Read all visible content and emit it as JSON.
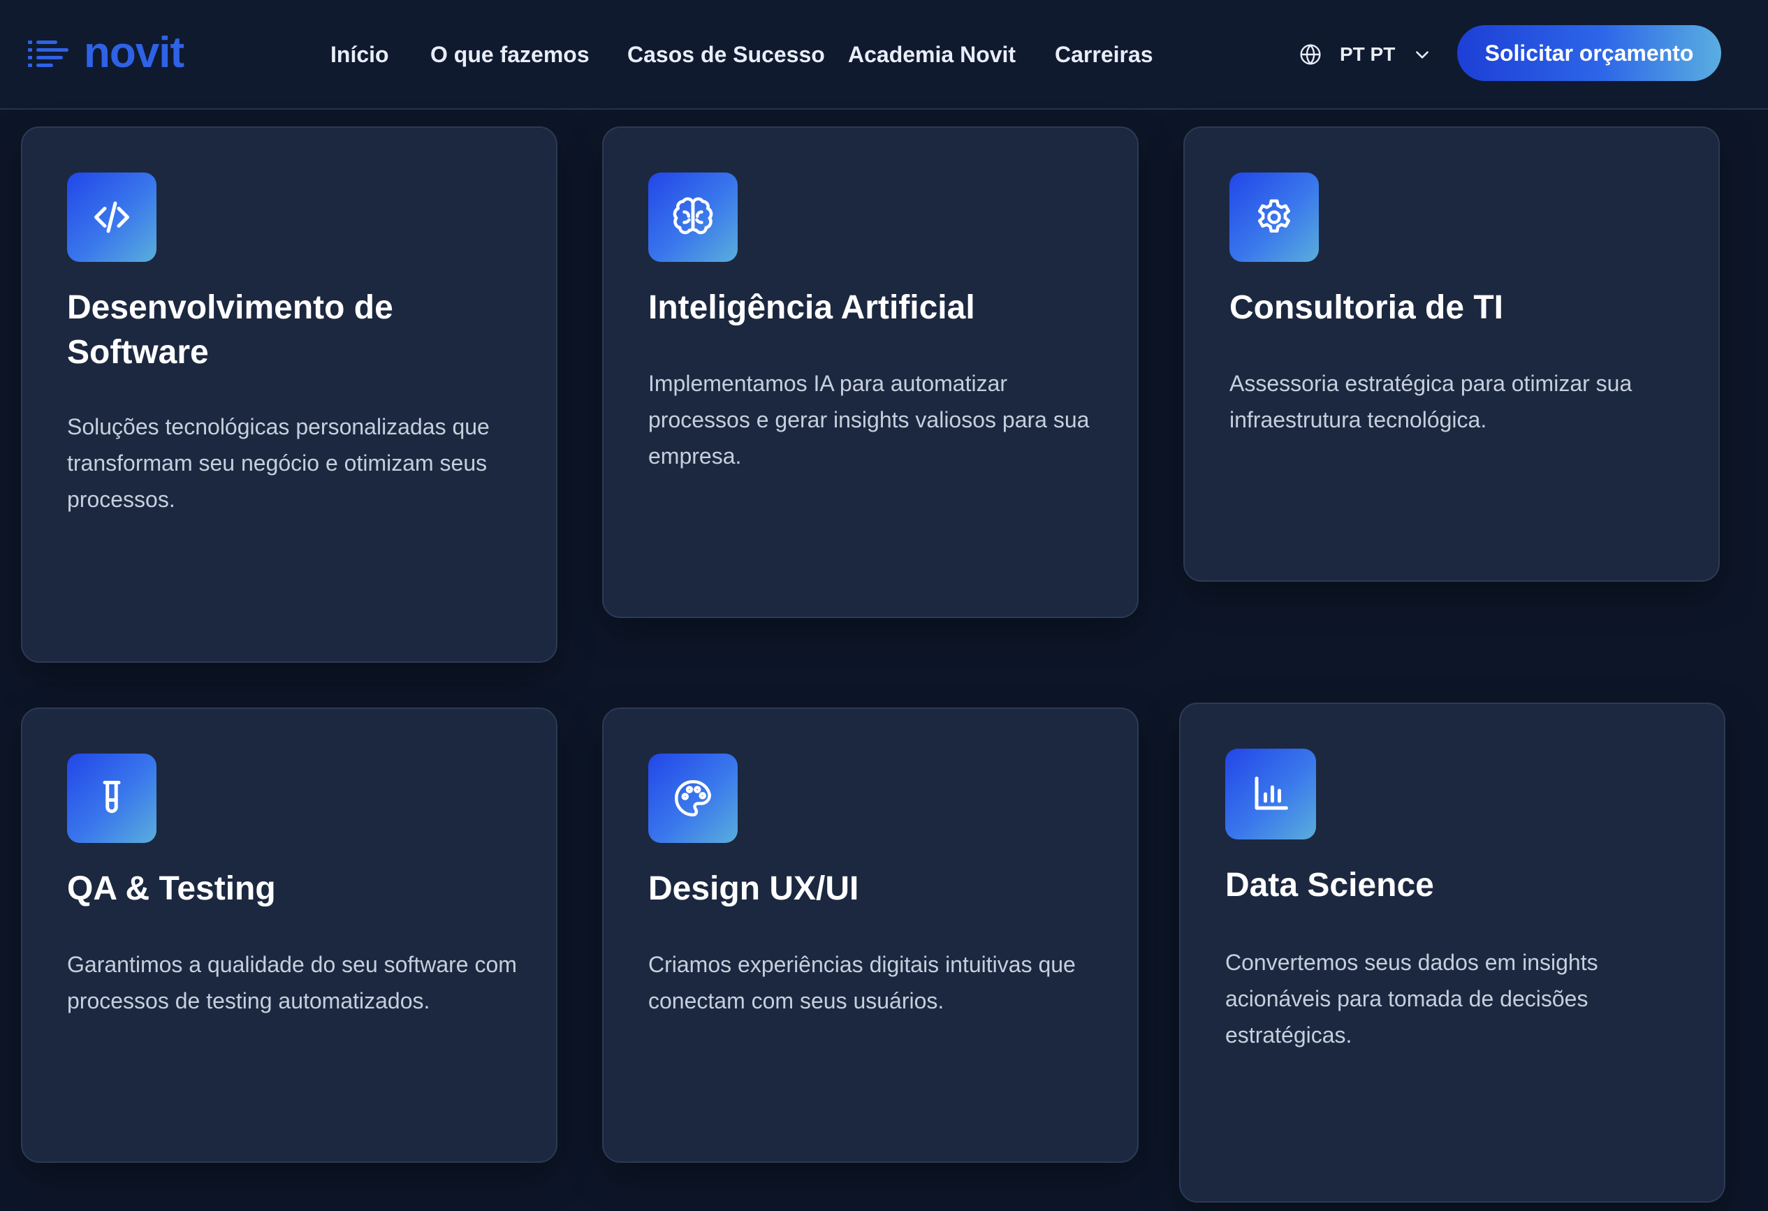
{
  "header": {
    "logo_text": "novit",
    "nav": [
      {
        "label": "Início"
      },
      {
        "label": "O que fazemos"
      },
      {
        "label": "Casos de Sucesso"
      },
      {
        "label": "Academia Novit"
      },
      {
        "label": "Carreiras"
      }
    ],
    "language": {
      "label": "PT PT"
    },
    "cta_label": "Solicitar orçamento"
  },
  "services": [
    {
      "icon": "code-icon",
      "title": "Desenvolvimento de Software",
      "description": "Soluções tecnológicas personalizadas que transformam seu negócio e otimizam seus processos."
    },
    {
      "icon": "brain-icon",
      "title": "Inteligência Artificial",
      "description": "Implementamos IA para automatizar processos e gerar insights valiosos para sua empresa."
    },
    {
      "icon": "gear-icon",
      "title": "Consultoria de TI",
      "description": "Assessoria estratégica para otimizar sua infraestrutura tecnológica."
    },
    {
      "icon": "test-tube-icon",
      "title": "QA & Testing",
      "description": "Garantimos a qualidade do seu software com processos de testing automatizados."
    },
    {
      "icon": "palette-icon",
      "title": "Design UX/UI",
      "description": "Criamos experiências digitais intuitivas que conectam com seus usuários."
    },
    {
      "icon": "bar-chart-icon",
      "title": "Data Science",
      "description": "Convertemos seus dados em insights acionáveis para tomada de decisões estratégicas."
    }
  ],
  "colors": {
    "background": "#0d1628",
    "header": "#0f1a2f",
    "card": "#1c2840",
    "brand": "#2f62e6",
    "accent_gradient_start": "#1d3fd6",
    "accent_gradient_end": "#5aaee0"
  }
}
